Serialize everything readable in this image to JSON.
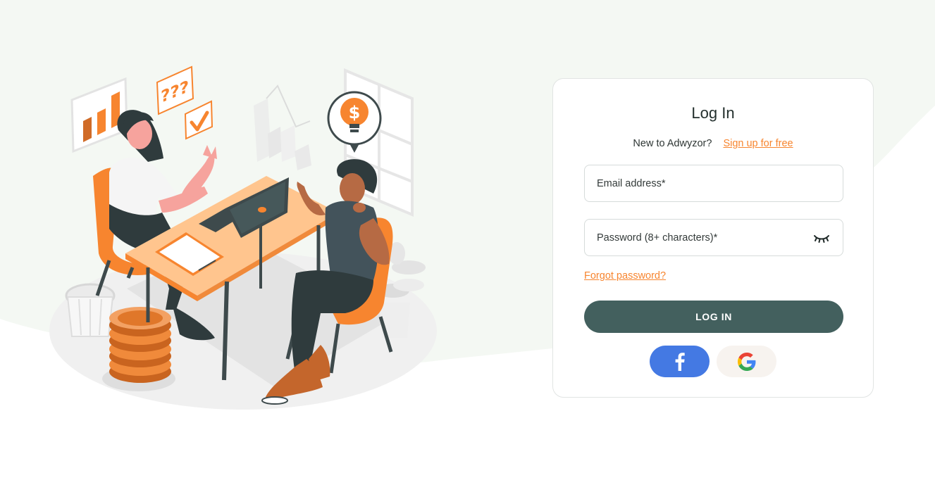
{
  "login": {
    "title": "Log In",
    "signup_prompt": "New to Adwyzor?",
    "signup_link": "Sign up for free",
    "email_placeholder": "Email address*",
    "password_placeholder": "Password (8+ characters)*",
    "forgot_password": "Forgot password?",
    "login_button": "LOG IN"
  },
  "social": {
    "facebook_icon": "facebook-icon",
    "google_icon": "google-icon"
  },
  "illustration": {
    "question_marks": "???",
    "currency_symbol": "$"
  },
  "colors": {
    "accent_orange": "#f7852f",
    "primary_button": "#43605e",
    "facebook_blue": "#4479e3",
    "google_bg": "#f7f3ef",
    "background_wave": "#f4f8f3",
    "card_border": "#e1e4e3"
  }
}
